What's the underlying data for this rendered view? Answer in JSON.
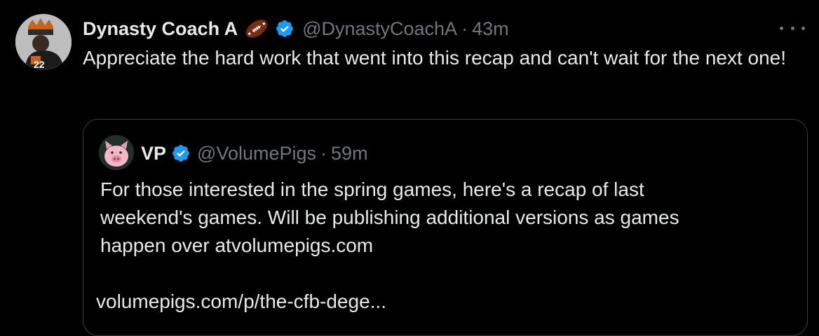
{
  "tweet": {
    "author": {
      "display_name": "Dynasty Coach A",
      "emoji_icon": "american-football-emoji",
      "handle": "@DynastyCoachA",
      "separator": "·",
      "time": "43m",
      "avatar_number": "22"
    },
    "text": "Appreciate the hard work that went into this recap and can't wait for the next one!",
    "more_icon": "more-dots-icon",
    "quote": {
      "author": {
        "display_name": "VP",
        "handle": "@VolumePigs",
        "separator": "·",
        "time": "59m"
      },
      "lines": [
        "For those interested in the spring games, here's a recap of last",
        "weekend's games. Will be publishing additional versions as games",
        "happen over atvolumepigs.com"
      ],
      "link": "volumepigs.com/p/the-cfb-dege..."
    }
  },
  "colors": {
    "background": "#000000",
    "primary_text": "#e7e9ea",
    "secondary_text": "#71767b",
    "verified_blue": "#1d9bf0",
    "quote_border": "#3a3d40"
  }
}
